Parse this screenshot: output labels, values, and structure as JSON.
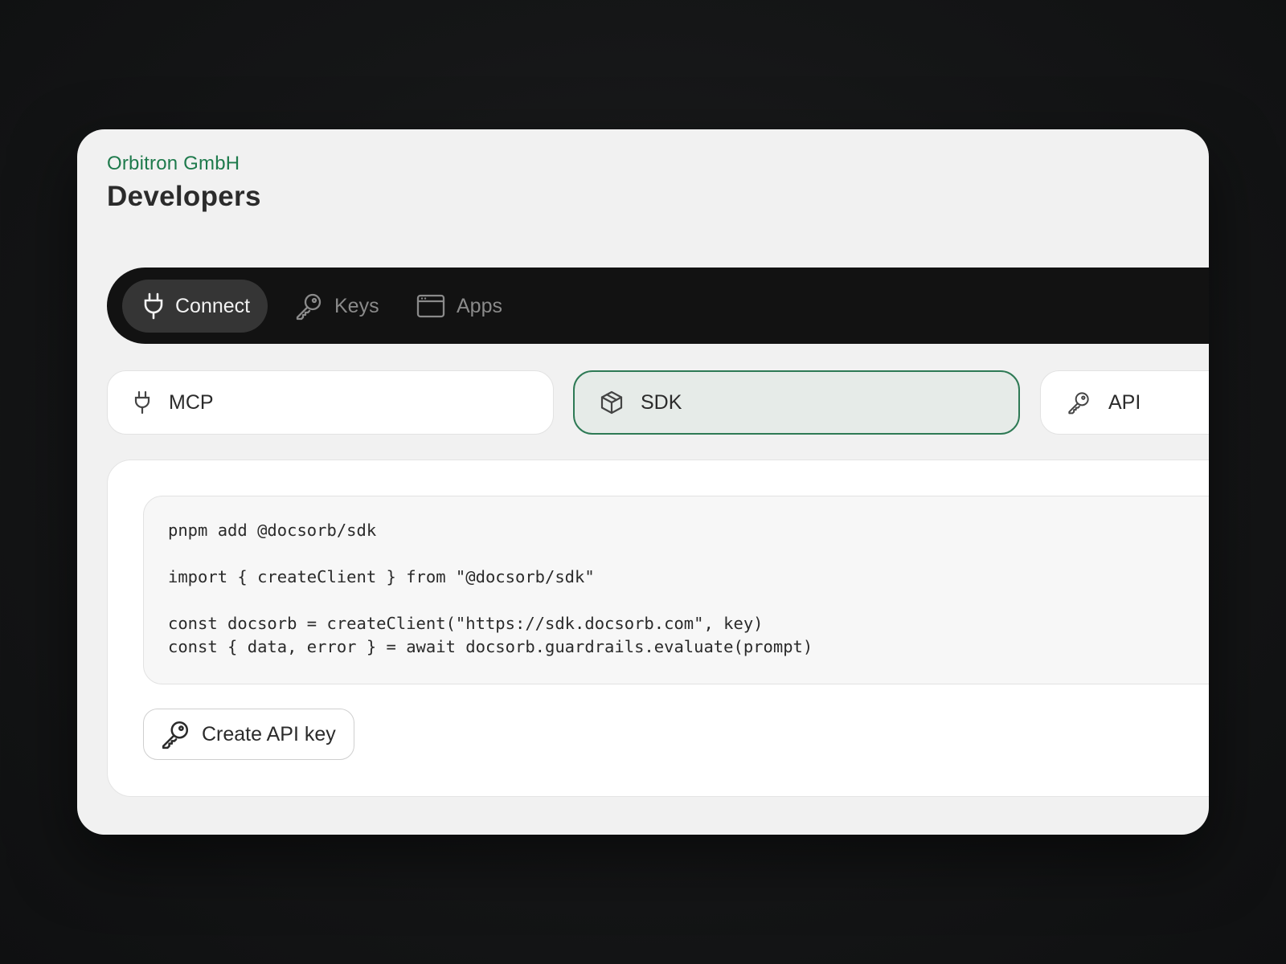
{
  "header": {
    "company": "Orbitron GmbH",
    "title": "Developers"
  },
  "tabs": [
    {
      "label": "Connect",
      "icon": "plug-icon",
      "active": true
    },
    {
      "label": "Keys",
      "icon": "key-icon",
      "active": false
    },
    {
      "label": "Apps",
      "icon": "app-window-icon",
      "active": false
    }
  ],
  "options": [
    {
      "label": "MCP",
      "icon": "plug-icon",
      "selected": false
    },
    {
      "label": "SDK",
      "icon": "package-icon",
      "selected": true
    },
    {
      "label": "API",
      "icon": "key-icon",
      "selected": false
    }
  ],
  "code": {
    "lines": [
      "pnpm add @docsorb/sdk",
      "",
      "import { createClient } from \"@docsorb/sdk\"",
      "",
      "const docsorb = createClient(\"https://sdk.docsorb.com\", key)",
      "const { data, error } = await docsorb.guardrails.evaluate(prompt)"
    ]
  },
  "actions": {
    "create_api_key_label": "Create API key"
  },
  "colors": {
    "accent": "#1e7a4c",
    "selected_border": "#2e7a55",
    "selected_bg": "#e6ebe8",
    "tabbar_bg": "#121212",
    "active_tab_bg": "#353535"
  }
}
